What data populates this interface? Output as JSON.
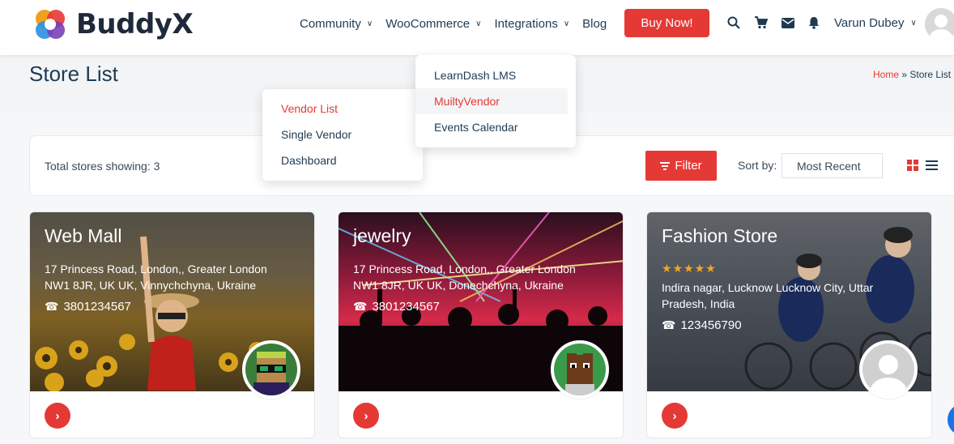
{
  "brand": {
    "name": "BuddyX"
  },
  "nav": {
    "items": [
      {
        "label": "Community",
        "has_dropdown": true
      },
      {
        "label": "WooCommerce",
        "has_dropdown": true
      },
      {
        "label": "Integrations",
        "has_dropdown": true
      },
      {
        "label": "Blog",
        "has_dropdown": false
      }
    ],
    "buy_label": "Buy Now!",
    "icons": [
      "search-icon",
      "cart-icon",
      "mail-icon",
      "bell-icon"
    ],
    "user_name": "Varun Dubey"
  },
  "page": {
    "title": "Store List",
    "breadcrumb": {
      "home": "Home",
      "separator": "»",
      "current": "Store List"
    }
  },
  "dropdowns": {
    "woocommerce": [
      {
        "label": "Vendor List",
        "active": true
      },
      {
        "label": "Single Vendor",
        "active": false
      },
      {
        "label": "Dashboard",
        "active": false
      }
    ],
    "integrations": [
      {
        "label": "LearnDash LMS",
        "active": false
      },
      {
        "label": "MuiltyVendor",
        "active": true
      },
      {
        "label": "Events Calendar",
        "active": false
      }
    ]
  },
  "filterbar": {
    "total_label": "Total stores showing: 3",
    "filter_label": "Filter",
    "sort_label": "Sort by:",
    "sort_value": "Most Recent"
  },
  "stores": [
    {
      "name": "Web Mall",
      "address": "17 Princess Road, London,, Greater London NW1 8JR, UK UK, Vinnychchyna, Ukraine",
      "phone": "3801234567",
      "rating": null
    },
    {
      "name": "jewelry",
      "address": "17 Princess Road, London,, Greater London NW1 8JR, UK UK, Donechchyna, Ukraine",
      "phone": "3801234567",
      "rating": null
    },
    {
      "name": "Fashion Store",
      "address": "Indira nagar, Lucknow Lucknow City, Uttar Pradesh, India",
      "phone": "123456790",
      "rating": 5
    }
  ],
  "colors": {
    "accent": "#e53935",
    "text": "#1e3a52",
    "star": "#f5a623"
  }
}
